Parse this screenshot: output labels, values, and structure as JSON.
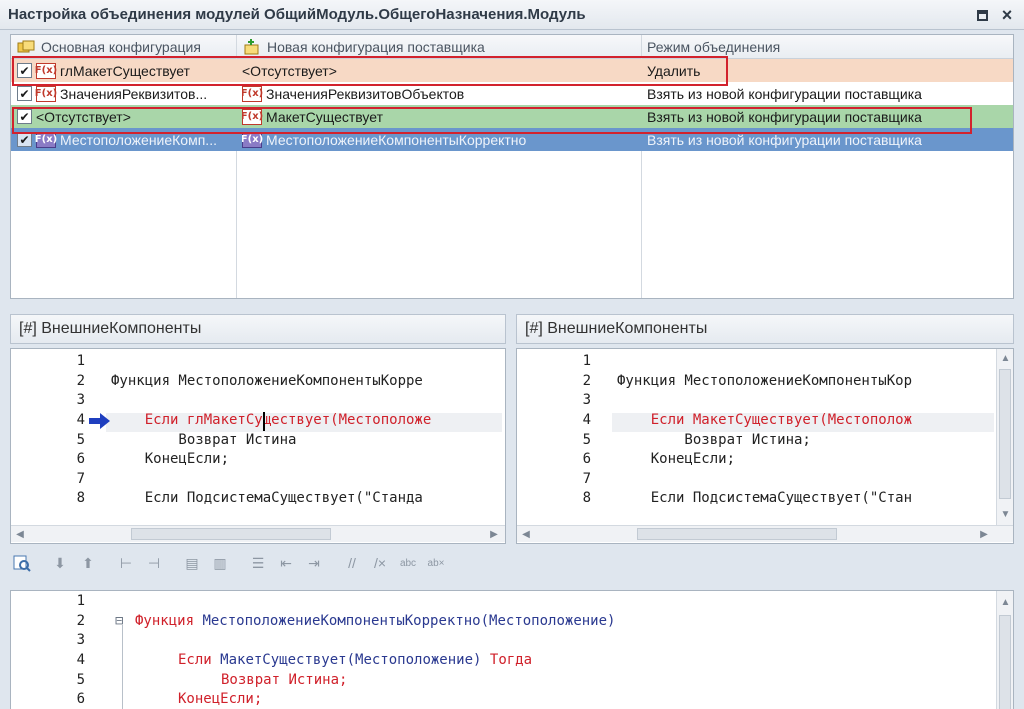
{
  "window": {
    "title": "Настройка объединения модулей ОбщийМодуль.ОбщегоНазначения.Модуль"
  },
  "table": {
    "headers": [
      "Основная конфигурация",
      "Новая конфигурация поставщика",
      "Режим объединения"
    ],
    "rows": [
      {
        "main": "глМакетСуществует",
        "vendor": "<Отсутствует>",
        "mode": "Удалить",
        "main_icon": true,
        "vendor_icon": false
      },
      {
        "main": "ЗначенияРеквизитов...",
        "vendor": "ЗначенияРеквизитовОбъектов",
        "mode": "Взять из новой конфигурации поставщика",
        "main_icon": true,
        "vendor_icon": true
      },
      {
        "main": "<Отсутствует>",
        "vendor": "МакетСуществует",
        "mode": "Взять из новой конфигурации поставщика",
        "main_icon": false,
        "vendor_icon": true
      },
      {
        "main": "МестоположениеКомп...",
        "vendor": "МестоположениеКомпонентыКорректно",
        "mode": "Взять из новой конфигурации поставщика",
        "main_icon": true,
        "vendor_icon": true
      }
    ]
  },
  "left_panel": {
    "title": "[#] ВнешниеКомпоненты",
    "line_numbers": [
      "1",
      "2",
      "3",
      "4",
      "5",
      "6",
      "7",
      "8"
    ],
    "lines": [
      "",
      "Функция МестоположениеКомпонентыКорре",
      "",
      "    Если глМакетСуществует(Местоположе",
      "        Возврат Истина",
      "    КонецЕсли;",
      "",
      "    Если ПодсистемаСуществует(\"Станда"
    ]
  },
  "right_panel": {
    "title": "[#] ВнешниеКомпоненты",
    "line_numbers": [
      "1",
      "2",
      "3",
      "4",
      "5",
      "6",
      "7",
      "8"
    ],
    "lines": [
      "",
      "Функция МестоположениеКомпонентыКор",
      "",
      "    Если МакетСуществует(Местополож",
      "        Возврат Истина;",
      "    КонецЕсли;",
      "",
      "    Если ПодсистемаСуществует(\"Стан"
    ]
  },
  "bottom_panel": {
    "line_numbers": [
      "1",
      "2",
      "3",
      "4",
      "5",
      "6"
    ],
    "fold_marker": "⊟",
    "line2": {
      "kw": "Функция",
      "name": "МестоположениеКомпонентыКорректно",
      "args": "(Местоположение)"
    },
    "line4": {
      "kw": "Если",
      "name": "МакетСуществует",
      "args": "(Местоположение)",
      "kw2": "Тогда"
    },
    "line5": {
      "kw": "Возврат",
      "value": "Истина;"
    },
    "line6": {
      "kw": "КонецЕсли;"
    }
  },
  "toolbar": {
    "icons": [
      "compare-icon",
      "arrow-down-icon",
      "arrow-up-icon",
      "tree-expand-icon",
      "tree-collapse-icon",
      "copy-left-icon",
      "copy-right-icon",
      "indent-icon",
      "outdent-left-icon",
      "outdent-right-icon",
      "comment-icon",
      "uncomment-icon",
      "spell-check-icon",
      "spell-uncheck-icon"
    ]
  },
  "colors": {
    "row_delete": "#f7d9c5",
    "row_added": "#a9d6a9",
    "row_selected": "#6a96cc",
    "highlight_border": "#d2222d",
    "keyword_red": "#d0202a",
    "keyword_blue": "#2a3990"
  }
}
